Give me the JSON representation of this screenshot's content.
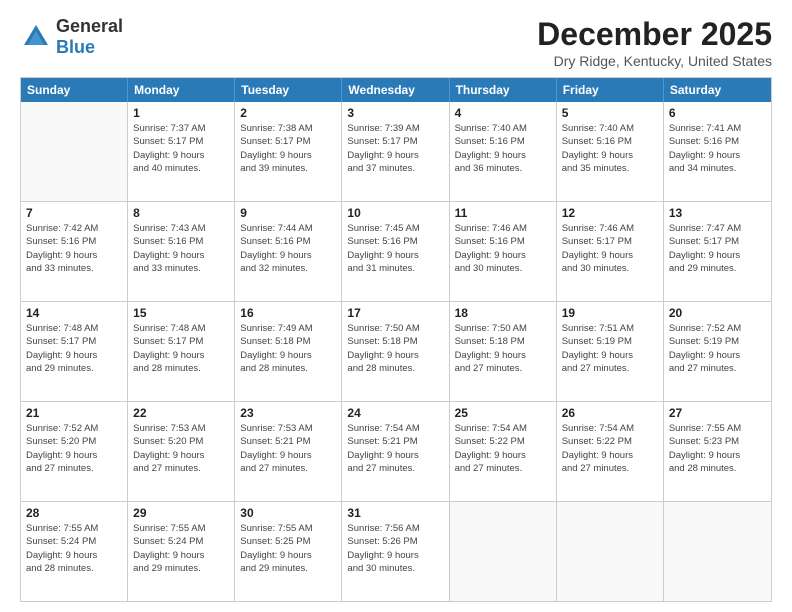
{
  "header": {
    "logo": {
      "general": "General",
      "blue": "Blue"
    },
    "title": "December 2025",
    "location": "Dry Ridge, Kentucky, United States"
  },
  "days_of_week": [
    "Sunday",
    "Monday",
    "Tuesday",
    "Wednesday",
    "Thursday",
    "Friday",
    "Saturday"
  ],
  "weeks": [
    [
      {
        "day": "",
        "empty": true
      },
      {
        "day": "1",
        "sunrise": "Sunrise: 7:37 AM",
        "sunset": "Sunset: 5:17 PM",
        "daylight": "Daylight: 9 hours and 40 minutes."
      },
      {
        "day": "2",
        "sunrise": "Sunrise: 7:38 AM",
        "sunset": "Sunset: 5:17 PM",
        "daylight": "Daylight: 9 hours and 39 minutes."
      },
      {
        "day": "3",
        "sunrise": "Sunrise: 7:39 AM",
        "sunset": "Sunset: 5:17 PM",
        "daylight": "Daylight: 9 hours and 37 minutes."
      },
      {
        "day": "4",
        "sunrise": "Sunrise: 7:40 AM",
        "sunset": "Sunset: 5:16 PM",
        "daylight": "Daylight: 9 hours and 36 minutes."
      },
      {
        "day": "5",
        "sunrise": "Sunrise: 7:40 AM",
        "sunset": "Sunset: 5:16 PM",
        "daylight": "Daylight: 9 hours and 35 minutes."
      },
      {
        "day": "6",
        "sunrise": "Sunrise: 7:41 AM",
        "sunset": "Sunset: 5:16 PM",
        "daylight": "Daylight: 9 hours and 34 minutes."
      }
    ],
    [
      {
        "day": "7",
        "sunrise": "Sunrise: 7:42 AM",
        "sunset": "Sunset: 5:16 PM",
        "daylight": "Daylight: 9 hours and 33 minutes."
      },
      {
        "day": "8",
        "sunrise": "Sunrise: 7:43 AM",
        "sunset": "Sunset: 5:16 PM",
        "daylight": "Daylight: 9 hours and 33 minutes."
      },
      {
        "day": "9",
        "sunrise": "Sunrise: 7:44 AM",
        "sunset": "Sunset: 5:16 PM",
        "daylight": "Daylight: 9 hours and 32 minutes."
      },
      {
        "day": "10",
        "sunrise": "Sunrise: 7:45 AM",
        "sunset": "Sunset: 5:16 PM",
        "daylight": "Daylight: 9 hours and 31 minutes."
      },
      {
        "day": "11",
        "sunrise": "Sunrise: 7:46 AM",
        "sunset": "Sunset: 5:16 PM",
        "daylight": "Daylight: 9 hours and 30 minutes."
      },
      {
        "day": "12",
        "sunrise": "Sunrise: 7:46 AM",
        "sunset": "Sunset: 5:17 PM",
        "daylight": "Daylight: 9 hours and 30 minutes."
      },
      {
        "day": "13",
        "sunrise": "Sunrise: 7:47 AM",
        "sunset": "Sunset: 5:17 PM",
        "daylight": "Daylight: 9 hours and 29 minutes."
      }
    ],
    [
      {
        "day": "14",
        "sunrise": "Sunrise: 7:48 AM",
        "sunset": "Sunset: 5:17 PM",
        "daylight": "Daylight: 9 hours and 29 minutes."
      },
      {
        "day": "15",
        "sunrise": "Sunrise: 7:48 AM",
        "sunset": "Sunset: 5:17 PM",
        "daylight": "Daylight: 9 hours and 28 minutes."
      },
      {
        "day": "16",
        "sunrise": "Sunrise: 7:49 AM",
        "sunset": "Sunset: 5:18 PM",
        "daylight": "Daylight: 9 hours and 28 minutes."
      },
      {
        "day": "17",
        "sunrise": "Sunrise: 7:50 AM",
        "sunset": "Sunset: 5:18 PM",
        "daylight": "Daylight: 9 hours and 28 minutes."
      },
      {
        "day": "18",
        "sunrise": "Sunrise: 7:50 AM",
        "sunset": "Sunset: 5:18 PM",
        "daylight": "Daylight: 9 hours and 27 minutes."
      },
      {
        "day": "19",
        "sunrise": "Sunrise: 7:51 AM",
        "sunset": "Sunset: 5:19 PM",
        "daylight": "Daylight: 9 hours and 27 minutes."
      },
      {
        "day": "20",
        "sunrise": "Sunrise: 7:52 AM",
        "sunset": "Sunset: 5:19 PM",
        "daylight": "Daylight: 9 hours and 27 minutes."
      }
    ],
    [
      {
        "day": "21",
        "sunrise": "Sunrise: 7:52 AM",
        "sunset": "Sunset: 5:20 PM",
        "daylight": "Daylight: 9 hours and 27 minutes."
      },
      {
        "day": "22",
        "sunrise": "Sunrise: 7:53 AM",
        "sunset": "Sunset: 5:20 PM",
        "daylight": "Daylight: 9 hours and 27 minutes."
      },
      {
        "day": "23",
        "sunrise": "Sunrise: 7:53 AM",
        "sunset": "Sunset: 5:21 PM",
        "daylight": "Daylight: 9 hours and 27 minutes."
      },
      {
        "day": "24",
        "sunrise": "Sunrise: 7:54 AM",
        "sunset": "Sunset: 5:21 PM",
        "daylight": "Daylight: 9 hours and 27 minutes."
      },
      {
        "day": "25",
        "sunrise": "Sunrise: 7:54 AM",
        "sunset": "Sunset: 5:22 PM",
        "daylight": "Daylight: 9 hours and 27 minutes."
      },
      {
        "day": "26",
        "sunrise": "Sunrise: 7:54 AM",
        "sunset": "Sunset: 5:22 PM",
        "daylight": "Daylight: 9 hours and 27 minutes."
      },
      {
        "day": "27",
        "sunrise": "Sunrise: 7:55 AM",
        "sunset": "Sunset: 5:23 PM",
        "daylight": "Daylight: 9 hours and 28 minutes."
      }
    ],
    [
      {
        "day": "28",
        "sunrise": "Sunrise: 7:55 AM",
        "sunset": "Sunset: 5:24 PM",
        "daylight": "Daylight: 9 hours and 28 minutes."
      },
      {
        "day": "29",
        "sunrise": "Sunrise: 7:55 AM",
        "sunset": "Sunset: 5:24 PM",
        "daylight": "Daylight: 9 hours and 29 minutes."
      },
      {
        "day": "30",
        "sunrise": "Sunrise: 7:55 AM",
        "sunset": "Sunset: 5:25 PM",
        "daylight": "Daylight: 9 hours and 29 minutes."
      },
      {
        "day": "31",
        "sunrise": "Sunrise: 7:56 AM",
        "sunset": "Sunset: 5:26 PM",
        "daylight": "Daylight: 9 hours and 30 minutes."
      },
      {
        "day": "",
        "empty": true
      },
      {
        "day": "",
        "empty": true
      },
      {
        "day": "",
        "empty": true
      }
    ]
  ]
}
